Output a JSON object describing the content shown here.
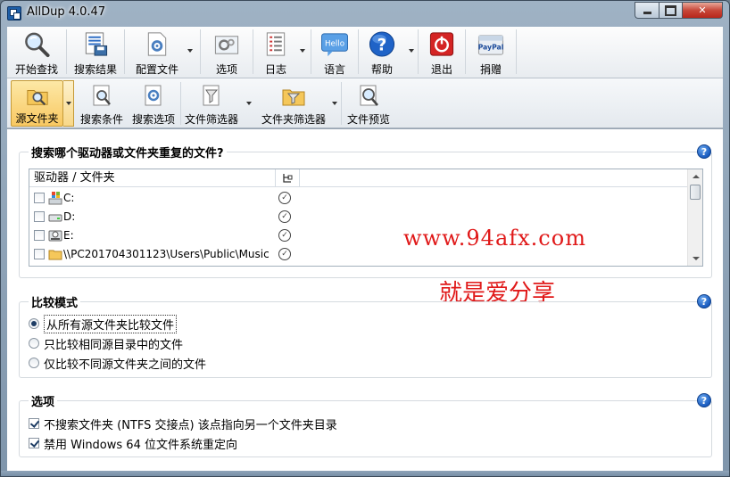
{
  "window": {
    "title": "AllDup 4.0.47"
  },
  "toolbar_main": {
    "items": [
      {
        "label": "开始查找",
        "icon": "magnifier-icon"
      },
      {
        "label": "搜索结果",
        "icon": "results-icon"
      },
      {
        "label": "配置文件",
        "icon": "config-file-icon"
      },
      {
        "label": "选项",
        "icon": "options-gear-icon"
      },
      {
        "label": "日志",
        "icon": "log-icon"
      },
      {
        "label": "语言",
        "icon": "hello-bubble-icon"
      },
      {
        "label": "帮助",
        "icon": "help-icon"
      },
      {
        "label": "退出",
        "icon": "exit-icon"
      },
      {
        "label": "捐赠",
        "icon": "paypal-icon"
      }
    ],
    "hello_text": "Hello",
    "paypal_text": "PayPal"
  },
  "toolbar_sub": {
    "items": [
      {
        "label": "源文件夹",
        "active": true
      },
      {
        "label": "搜索条件"
      },
      {
        "label": "搜索选项"
      },
      {
        "label": "文件筛选器"
      },
      {
        "label": "文件夹筛选器"
      },
      {
        "label": "文件预览"
      }
    ]
  },
  "source_group": {
    "title": "搜索哪个驱动器或文件夹重复的文件?",
    "column_header": "驱动器 / 文件夹",
    "rows": [
      {
        "path": "C:",
        "icon": "windows-drive-icon",
        "checked": false
      },
      {
        "path": "D:",
        "icon": "drive-icon",
        "checked": false
      },
      {
        "path": "E:",
        "icon": "drive-icon",
        "checked": false
      },
      {
        "path": "\\\\PC201704301123\\Users\\Public\\Music",
        "icon": "folder-icon",
        "checked": false
      }
    ]
  },
  "watermark": {
    "url": "www.94afx.com",
    "slogan": "就是爱分享"
  },
  "compare_group": {
    "title": "比较模式",
    "options": [
      {
        "label": "从所有源文件夹比较文件",
        "selected": true
      },
      {
        "label": "只比较相同源目录中的文件",
        "selected": false
      },
      {
        "label": "仅比较不同源文件夹之间的文件",
        "selected": false
      }
    ]
  },
  "options_group": {
    "title": "选项",
    "options": [
      {
        "label": "不搜索文件夹 (NTFS 交接点) 该点指向另一个文件夹目录",
        "checked": true
      },
      {
        "label": "禁用 Windows 64 位文件系统重定向",
        "checked": true
      }
    ]
  },
  "help_glyph": "?",
  "colors": {
    "accent_active": "#f8c862",
    "watermark": "#e01919",
    "help_blue": "#1a5cc0"
  }
}
